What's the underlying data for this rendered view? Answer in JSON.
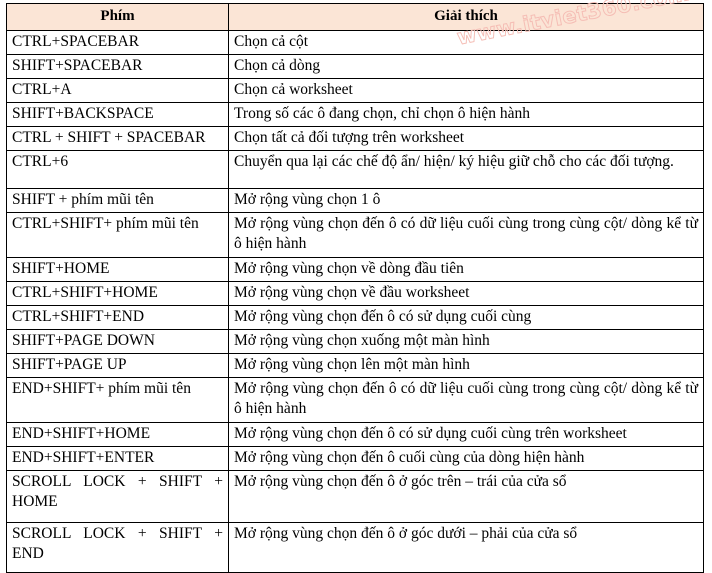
{
  "document": {
    "title": "Excel keyboard shortcuts table",
    "watermark": "www.itviet360.com",
    "watermark_color": "#f5bcb4",
    "header_bg": "#fbe5d6"
  },
  "table": {
    "headers": [
      "Phím",
      "Giải thích"
    ],
    "rows": [
      {
        "key": "CTRL+SPACEBAR",
        "desc": "Chọn cả cột"
      },
      {
        "key": "SHIFT+SPACEBAR",
        "desc": "Chọn cả dòng"
      },
      {
        "key": "CTRL+A",
        "desc": "Chọn cả worksheet"
      },
      {
        "key": "SHIFT+BACKSPACE",
        "desc": "Trong số các ô đang chọn, chỉ chọn ô hiện hành"
      },
      {
        "key": "CTRL + SHIFT + SPACEBAR",
        "desc": "Chọn tất cả đối tượng trên worksheet"
      },
      {
        "key": "CTRL+6",
        "desc": "Chuyển qua lại các chế độ ẩn/ hiện/ ký hiệu giữ chỗ cho các đối tượng."
      },
      {
        "key": "SHIFT + phím mũi tên",
        "desc": "Mở rộng vùng chọn 1 ô"
      },
      {
        "key": "CTRL+SHIFT+ phím mũi tên",
        "desc": "Mở rộng vùng chọn đến ô có dữ liệu cuối cùng trong cùng cột/ dòng kể từ ô hiện hành"
      },
      {
        "key": "SHIFT+HOME",
        "desc": "Mở rộng vùng chọn về dòng đầu tiên"
      },
      {
        "key": "CTRL+SHIFT+HOME",
        "desc": "Mở rộng vùng chọn về đầu worksheet"
      },
      {
        "key": "CTRL+SHIFT+END",
        "desc": "Mở rộng vùng chọn đến ô có sử dụng cuối cùng"
      },
      {
        "key": "SHIFT+PAGE DOWN",
        "desc": "Mở rộng vùng chọn xuống một màn hình"
      },
      {
        "key": "SHIFT+PAGE UP",
        "desc": "Mở rộng vùng chọn lên một màn hình"
      },
      {
        "key": "END+SHIFT+ phím mũi tên",
        "desc": "Mở rộng vùng chọn đến ô có dữ liệu cuối cùng trong cùng cột/ dòng kể từ ô hiện hành"
      },
      {
        "key": "END+SHIFT+HOME",
        "desc": "Mở rộng vùng chọn đến ô có sử dụng cuối cùng trên worksheet"
      },
      {
        "key": "END+SHIFT+ENTER",
        "desc": "Mở rộng vùng chọn đến ô cuối cùng của dòng hiện hành"
      },
      {
        "key": "SCROLL LOCK + SHIFT + HOME",
        "desc": "Mở rộng vùng chọn đến ô ở góc trên – trái của cửa sổ"
      },
      {
        "key": "SCROLL LOCK + SHIFT + END",
        "desc": "Mở rộng vùng chọn đến ô ở góc dưới – phải của cửa sổ"
      }
    ]
  }
}
